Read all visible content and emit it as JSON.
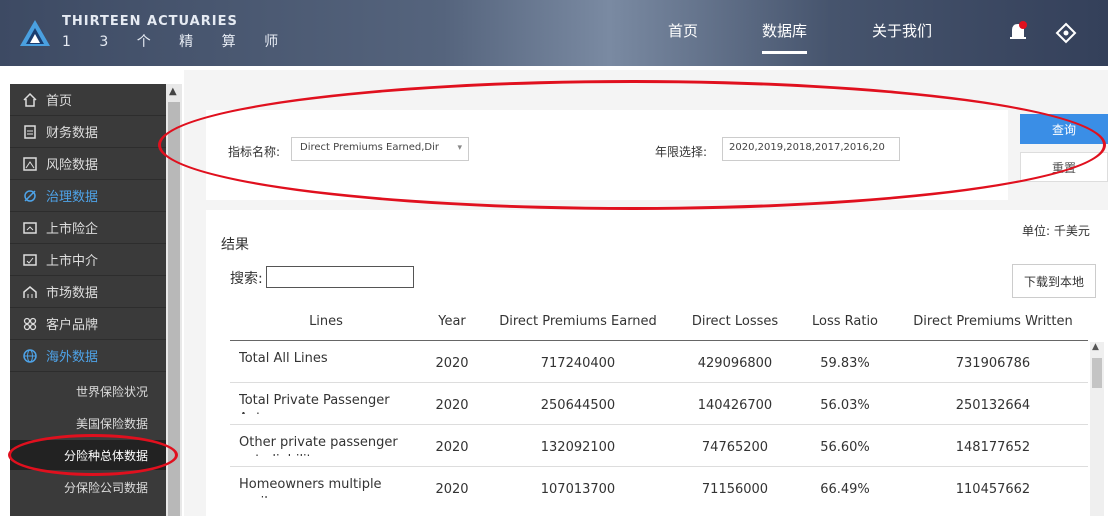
{
  "header": {
    "brand_en": "THIRTEEN ACTUARIES",
    "brand_cn": "1 3 个 精 算 师",
    "nav": [
      {
        "label": "首页"
      },
      {
        "label": "数据库"
      },
      {
        "label": "关于我们"
      }
    ]
  },
  "sidebar": {
    "items": [
      {
        "label": "首页",
        "icon": "home-icon"
      },
      {
        "label": "财务数据",
        "icon": "document-icon"
      },
      {
        "label": "风险数据",
        "icon": "risk-icon"
      },
      {
        "label": "治理数据",
        "icon": "governance-icon"
      },
      {
        "label": "上市险企",
        "icon": "listed-insurer-icon"
      },
      {
        "label": "上市中介",
        "icon": "listed-broker-icon"
      },
      {
        "label": "市场数据",
        "icon": "market-icon"
      },
      {
        "label": "客户品牌",
        "icon": "brand-icon"
      },
      {
        "label": "海外数据",
        "icon": "globe-icon"
      }
    ],
    "subitems": [
      {
        "label": "世界保险状况"
      },
      {
        "label": "美国保险数据"
      },
      {
        "label": "分险种总体数据"
      },
      {
        "label": "分保险公司数据"
      }
    ]
  },
  "filters": {
    "indicator_label": "指标名称:",
    "indicator_value": "Direct Premiums Earned,Dir",
    "year_label": "年限选择:",
    "year_value": "2020,2019,2018,2017,2016,20",
    "query_button": "查询",
    "reset_button": "重置"
  },
  "results": {
    "title": "结果",
    "unit": "单位: 千美元",
    "search_label": "搜索:",
    "search_value": "",
    "download_button": "下载到本地",
    "columns": [
      "Lines",
      "Year",
      "Direct Premiums Earned",
      "Direct Losses",
      "Loss Ratio",
      "Direct Premiums Written"
    ],
    "rows": [
      {
        "line": "Total All Lines",
        "year": "2020",
        "dpe": "717240400",
        "dl": "429096800",
        "lr": "59.83%",
        "dpw": "731906786"
      },
      {
        "line": "Total Private Passenger Auto",
        "year": "2020",
        "dpe": "250644500",
        "dl": "140426700",
        "lr": "56.03%",
        "dpw": "250132664"
      },
      {
        "line": "Other private passenger auto liability",
        "year": "2020",
        "dpe": "132092100",
        "dl": "74765200",
        "lr": "56.60%",
        "dpw": "148177652"
      },
      {
        "line": "Homeowners multiple peril",
        "year": "2020",
        "dpe": "107013700",
        "dl": "71156000",
        "lr": "66.49%",
        "dpw": "110457662"
      }
    ]
  },
  "colors": {
    "accent": "#3a8ee6",
    "highlight_circle": "#e0101e",
    "sidebar_bg": "#3a3a3a"
  }
}
